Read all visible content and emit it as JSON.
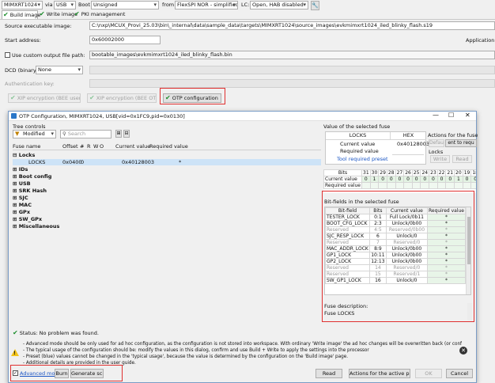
{
  "top": {
    "device": "MIMXRT1024",
    "via": "via",
    "usb": "USB",
    "boot": "Boot",
    "boot_type": "Unsigned",
    "from": "from",
    "flash": "FlexSPI NOR - simplified",
    "lc": "LC:",
    "lifecycle": "Open, HAB disabled"
  },
  "tabs": [
    "Build image",
    "Write image",
    "PKI management"
  ],
  "source": {
    "label": "Source executable image:",
    "value": "C:\\nxp\\MCUX_Provi_25.03\\bin\\_internal\\data\\sample_data\\targets\\MIMXRT1024\\source_images\\evkmimxrt1024_iled_blinky_flash.s19"
  },
  "start_address": {
    "label": "Start address:",
    "value": "0x60002000",
    "app_label": "Application ima"
  },
  "custom_output": {
    "label": "Use custom output file path:",
    "value": "bootable_images\\evkmimxrt1024_iled_blinky_flash.bin"
  },
  "dcd": {
    "label": "DCD (binary):",
    "value": "None"
  },
  "auth_key": {
    "label": "Authentication key:"
  },
  "enc_buttons": [
    "XIP encryption (BEE user keys)",
    "XIP encryption (BEE OTPMK)",
    "OTP configuration"
  ],
  "dialog": {
    "title": "OTP Configuration, MIMXRT1024, USB[vid=0x1FC9,pid=0x0130]",
    "tree_controls_label": "Tree controls",
    "filter": "Modified",
    "search_placeholder": "Search",
    "columns": [
      "Fuse name",
      "Offset",
      "#",
      "R",
      "W",
      "O",
      "Current value",
      "Required value"
    ],
    "tree": [
      {
        "name": "Locks",
        "expand": "⊟",
        "bold": true
      },
      {
        "name": "LOCKS",
        "offset": "0x0400",
        "num": "0",
        "current": "0x40128003",
        "required": "*",
        "selected": true
      },
      {
        "name": "IDs",
        "expand": "⊞",
        "bold": true
      },
      {
        "name": "Boot config",
        "expand": "⊞",
        "bold": true
      },
      {
        "name": "USB",
        "expand": "⊞",
        "bold": true
      },
      {
        "name": "SRK Hash",
        "expand": "⊞",
        "bold": true
      },
      {
        "name": "SJC",
        "expand": "⊞",
        "bold": true
      },
      {
        "name": "MAC",
        "expand": "⊞",
        "bold": true
      },
      {
        "name": "GPx",
        "expand": "⊞",
        "bold": true
      },
      {
        "name": "SW_GPx",
        "expand": "⊞",
        "bold": true
      },
      {
        "name": "Miscellaneous",
        "expand": "⊞",
        "bold": true
      }
    ],
    "value_section": {
      "title": "Value of the selected fuse",
      "col_locks": "LOCKS",
      "col_hex": "HEX",
      "current_label": "Current value",
      "current_value": "0x40128003",
      "required_label": "Required value",
      "tool_preset_label": "Tool required preset",
      "actions_title": "Actions for the fuse",
      "default_btn": "Default",
      "set_btn": "ent to requ",
      "locks_label": "Locks",
      "write_btn": "Write",
      "read_btn": "Read"
    },
    "bits": {
      "header": "Bits",
      "numbers": [
        "31",
        "30",
        "29",
        "28",
        "27",
        "26",
        "25",
        "24",
        "23",
        "22",
        "21",
        "20",
        "19",
        "18",
        "17",
        "16",
        "15",
        "14"
      ],
      "current_label": "Current value",
      "current_bits": [
        "0",
        "1",
        "0",
        "0",
        "0",
        "0",
        "0",
        "0",
        "0",
        "0",
        "0",
        "1",
        "0",
        "0",
        "1",
        "0",
        "1",
        "0"
      ],
      "required_label": "Required value"
    },
    "bitfields": {
      "title": "Bit-fields in the selected fuse",
      "columns": [
        "Bit-field",
        "Bits",
        "Current value",
        "Required value"
      ],
      "rows": [
        {
          "name": "TESTER_LOCK",
          "bits": "0:1",
          "current": "Full Lock/0b11",
          "required": "*",
          "reserved": false
        },
        {
          "name": "BOOT_CFG_LOCK",
          "bits": "2:3",
          "current": "Unlock/0b00",
          "required": "*",
          "reserved": false
        },
        {
          "name": "Reserved",
          "bits": "4:5",
          "current": "Reserved/0b00",
          "required": "*",
          "reserved": true
        },
        {
          "name": "SJC_RESP_LOCK",
          "bits": "6",
          "current": "Unlock/0",
          "required": "*",
          "reserved": false
        },
        {
          "name": "Reserved",
          "bits": "7",
          "current": "Reserved/0",
          "required": "*",
          "reserved": true
        },
        {
          "name": "MAC_ADDR_LOCK",
          "bits": "8:9",
          "current": "Unlock/0b00",
          "required": "*",
          "reserved": false
        },
        {
          "name": "GP1_LOCK",
          "bits": "10:11",
          "current": "Unlock/0b00",
          "required": "*",
          "reserved": false
        },
        {
          "name": "GP2_LOCK",
          "bits": "12:13",
          "current": "Unlock/0b00",
          "required": "*",
          "reserved": false
        },
        {
          "name": "Reserved",
          "bits": "14",
          "current": "Reserved/0",
          "required": "*",
          "reserved": true
        },
        {
          "name": "Reserved",
          "bits": "15",
          "current": "Reserved/1",
          "required": "*",
          "reserved": true
        },
        {
          "name": "SW_GP1_LOCK",
          "bits": "16",
          "current": "Unlock/0",
          "required": "*",
          "reserved": false
        }
      ]
    },
    "fuse_description_label": "Fuse description:",
    "fuse_description": "Fuse LOCKS",
    "status": "Status: No problem was found.",
    "notes": [
      "- Advanced mode should be only used for ad hoc configuration, as the configuration is not stored into workspace. With ordinary 'Write image' the ad hoc changes will be overwritten back (or conflict) with settings in t...",
      "- The typical usage of the configuration should be: modify the values in this dialog, confirm and use Build + Write to apply the settings into the processor",
      "- Preset (blue) values cannot be changed in the 'typical usage', because the value is determined by the configuration on the 'Build image' page.",
      "- Additional details are provided in the user guide."
    ],
    "bottom": {
      "advanced_mode": "Advanced mode",
      "burn": "Burn",
      "generate_script": "Generate script",
      "read": "Read",
      "actions_active": "Actions for the active page",
      "ok": "OK",
      "cancel": "Cancel"
    }
  }
}
